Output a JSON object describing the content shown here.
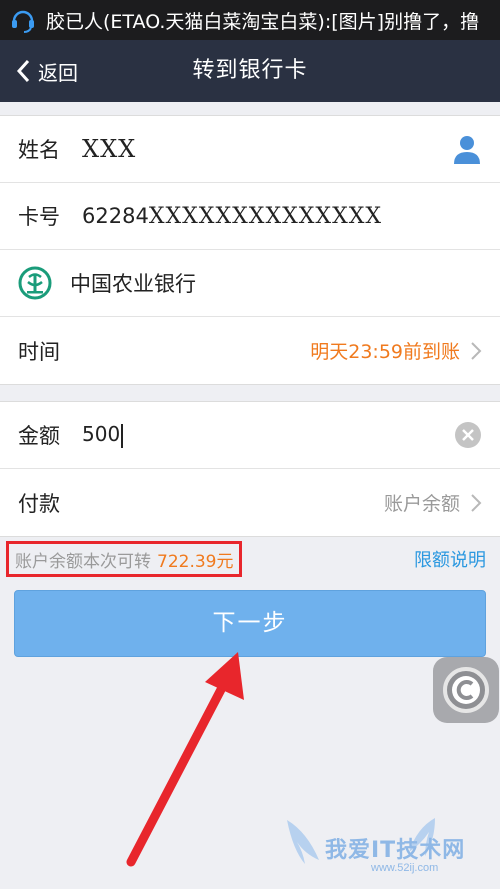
{
  "status_bar": {
    "notification_text": "胶已人(ETAO.天猫白菜淘宝白菜):[图片]别撸了，撸",
    "icon": "headset-icon"
  },
  "nav": {
    "back_label": "返回",
    "title": "转到银行卡"
  },
  "recipient": {
    "name_label": "姓名",
    "name_value": "XXX",
    "contact_icon": "contact-person-icon",
    "card_label": "卡号",
    "card_prefix": "62284",
    "card_masked": "XXXXXXXXXXXXXX",
    "bank_icon": "agricultural-bank-logo-icon",
    "bank_name": "中国农业银行",
    "time_label": "时间",
    "time_value": "明天23:59前到账"
  },
  "payment": {
    "amount_label": "金额",
    "amount_value": "500",
    "clear_icon": "clear-icon",
    "pay_label": "付款",
    "pay_value": "账户余额"
  },
  "balance": {
    "text": "账户余额本次可转",
    "amount": "722.39元",
    "limit_link": "限额说明"
  },
  "next_button": "下一步",
  "watermark": {
    "text": "我爱IT技术网",
    "url": "www.52ij.com"
  },
  "colors": {
    "nav_bg": "#2a3142",
    "accent_orange": "#f07a1e",
    "link_blue": "#2b98e0",
    "button_blue": "#6fb1ed",
    "highlight_red": "#e8262c"
  }
}
